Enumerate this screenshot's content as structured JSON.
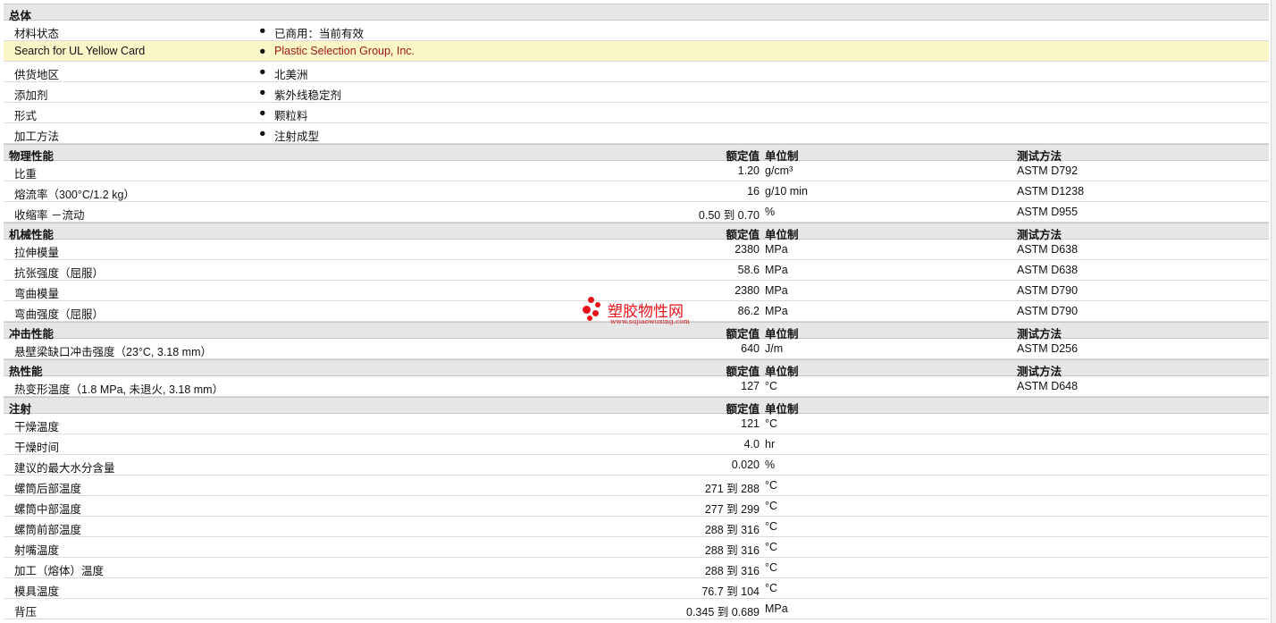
{
  "sections": [
    {
      "title": "总体",
      "type": "general",
      "rows": [
        {
          "label": "材料状态",
          "text": "已商用：当前有效"
        },
        {
          "label": "Search for UL Yellow Card",
          "text": "Plastic Selection Group, Inc.",
          "highlight": true,
          "link": true
        },
        {
          "label": "供货地区",
          "text": "北美洲"
        },
        {
          "label": "添加剂",
          "text": "紫外线稳定剂"
        },
        {
          "label": "形式",
          "text": "颗粒料"
        },
        {
          "label": "加工方法",
          "text": "注射成型"
        }
      ]
    },
    {
      "title": "物理性能",
      "type": "props",
      "h_value": "额定值",
      "h_unit": "单位制",
      "h_method": "测试方法",
      "rows": [
        {
          "label": "比重",
          "value": "1.20",
          "unit": "g/cm³",
          "method": "ASTM D792"
        },
        {
          "label": "熔流率（300°C/1.2 kg）",
          "value": "16",
          "unit": "g/10 min",
          "method": "ASTM D1238"
        },
        {
          "label": "收缩率 －流动",
          "value": "0.50 到  0.70",
          "unit": "%",
          "method": "ASTM D955"
        }
      ]
    },
    {
      "title": "机械性能",
      "type": "props",
      "h_value": "额定值",
      "h_unit": "单位制",
      "h_method": "测试方法",
      "rows": [
        {
          "label": "拉伸模量",
          "value": "2380",
          "unit": "MPa",
          "method": "ASTM D638"
        },
        {
          "label": "抗张强度（屈服）",
          "value": "58.6",
          "unit": "MPa",
          "method": "ASTM D638"
        },
        {
          "label": "弯曲模量",
          "value": "2380",
          "unit": "MPa",
          "method": "ASTM D790"
        },
        {
          "label": "弯曲强度（屈服）",
          "value": "86.2",
          "unit": "MPa",
          "method": "ASTM D790"
        }
      ]
    },
    {
      "title": "冲击性能",
      "type": "props",
      "h_value": "额定值",
      "h_unit": "单位制",
      "h_method": "测试方法",
      "rows": [
        {
          "label": "悬壁梁缺口冲击强度（23°C, 3.18 mm）",
          "value": "640",
          "unit": "J/m",
          "method": "ASTM D256"
        }
      ]
    },
    {
      "title": "热性能",
      "type": "props",
      "h_value": "额定值",
      "h_unit": "单位制",
      "h_method": "测试方法",
      "rows": [
        {
          "label": "热变形温度（1.8 MPa, 未退火, 3.18 mm）",
          "value": "127",
          "unit": "°C",
          "method": "ASTM D648"
        }
      ]
    },
    {
      "title": "注射",
      "type": "props",
      "h_value": "额定值",
      "h_unit": "单位制",
      "h_method": "",
      "rows": [
        {
          "label": "干燥温度",
          "value": "121",
          "unit": "°C"
        },
        {
          "label": "干燥时间",
          "value": "4.0",
          "unit": "hr"
        },
        {
          "label": "建议的最大水分含量",
          "value": "0.020",
          "unit": "%"
        },
        {
          "label": "螺筒后部温度",
          "value": "271 到  288",
          "unit": "°C"
        },
        {
          "label": "螺筒中部温度",
          "value": "277 到  299",
          "unit": "°C"
        },
        {
          "label": "螺筒前部温度",
          "value": "288 到  316",
          "unit": "°C"
        },
        {
          "label": "射嘴温度",
          "value": "288 到  316",
          "unit": "°C"
        },
        {
          "label": "加工（熔体）温度",
          "value": "288 到  316",
          "unit": "°C"
        },
        {
          "label": "模具温度",
          "value": "76.7 到  104",
          "unit": "°C"
        },
        {
          "label": "背压",
          "value": "0.345 到  0.689",
          "unit": "MPa"
        }
      ]
    }
  ],
  "bullet": "●",
  "watermark": {
    "title": "塑胶物性网",
    "url": "www.sujiaowuxing.com",
    "color": "#e8131b"
  }
}
